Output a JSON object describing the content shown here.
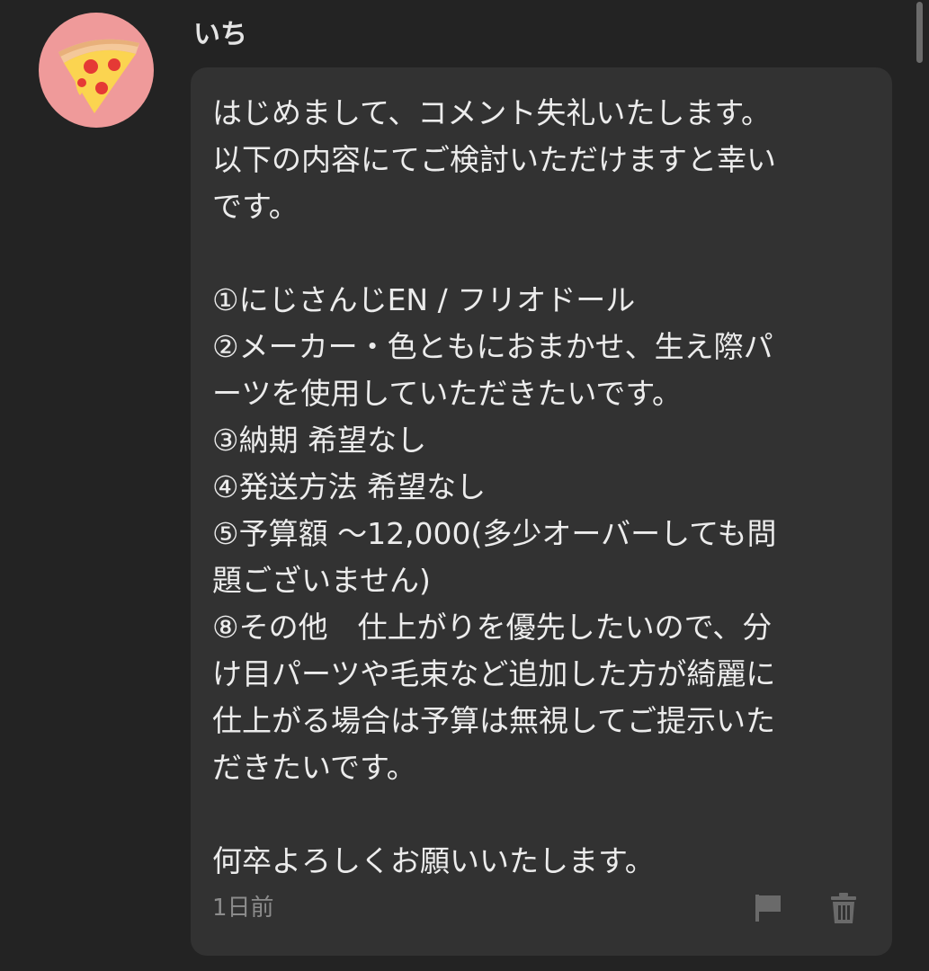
{
  "comment": {
    "author": {
      "name": "いち",
      "avatar_icon": "pizza-slice-icon",
      "avatar_bg": "#ef9a9a"
    },
    "body_lines": [
      "はじめまして、コメント失礼いたします。",
      "以下の内容にてご検討いただけますと幸い",
      "です。",
      "",
      "①にじさんじEN / フリオドール",
      "②メーカー・色ともにおまかせ、生え際パ",
      "ーツを使用していただきたいです。",
      "③納期 希望なし",
      "④発送方法 希望なし",
      "⑤予算額 〜12,000(多少オーバーしても問",
      "題ございません)",
      "⑧その他　仕上がりを優先したいので、分",
      "け目パーツや毛束など追加した方が綺麗に",
      "仕上がる場合は予算は無視してご提示いた",
      "だきたいです。",
      "",
      "何卒よろしくお願いいたします。"
    ],
    "timestamp": "1日前",
    "actions": {
      "report_icon": "flag-icon",
      "delete_icon": "trash-icon"
    }
  },
  "colors": {
    "background": "#232323",
    "bubble": "#323232",
    "text": "#ececec",
    "muted": "#8c8c8c",
    "icon": "#6a6a6a"
  }
}
